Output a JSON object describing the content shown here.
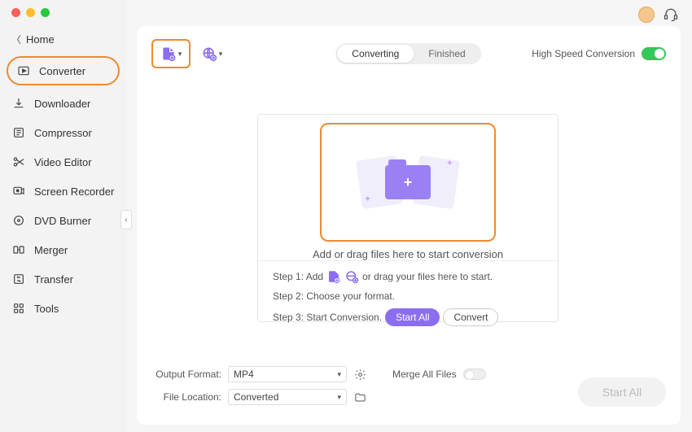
{
  "nav": {
    "home": "Home",
    "items": [
      {
        "label": "Converter"
      },
      {
        "label": "Downloader"
      },
      {
        "label": "Compressor"
      },
      {
        "label": "Video Editor"
      },
      {
        "label": "Screen Recorder"
      },
      {
        "label": "DVD Burner"
      },
      {
        "label": "Merger"
      },
      {
        "label": "Transfer"
      },
      {
        "label": "Tools"
      }
    ]
  },
  "tabs": {
    "converting": "Converting",
    "finished": "Finished"
  },
  "hspeed_label": "High Speed Conversion",
  "drop_text": "Add or drag files here to start conversion",
  "steps": {
    "s1a": "Step 1: Add",
    "s1b": "or drag your files here to start.",
    "s2": "Step 2: Choose your format.",
    "s3": "Step 3: Start Conversion.",
    "start_all": "Start  All",
    "convert": "Convert"
  },
  "bottom": {
    "output_format_label": "Output Format:",
    "output_format_value": "MP4",
    "file_location_label": "File Location:",
    "file_location_value": "Converted",
    "merge_label": "Merge All Files",
    "start_all_btn": "Start All"
  }
}
